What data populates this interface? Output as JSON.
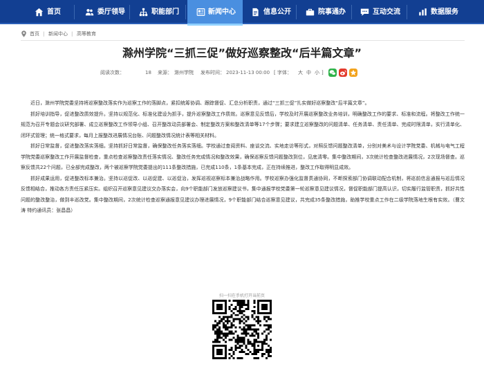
{
  "nav": {
    "items": [
      {
        "label": "首页",
        "icon": "home-icon"
      },
      {
        "label": "委厅领导",
        "icon": "people-icon"
      },
      {
        "label": "职能部门",
        "icon": "org-icon"
      },
      {
        "label": "新闻中心",
        "icon": "news-icon",
        "active": true
      },
      {
        "label": "信息公开",
        "icon": "document-icon"
      },
      {
        "label": "院事通办",
        "icon": "briefcase-icon"
      },
      {
        "label": "互动交流",
        "icon": "chat-icon"
      },
      {
        "label": "数据服务",
        "icon": "data-icon"
      }
    ],
    "colors": {
      "bar": "#123f92",
      "active": "#4a8fe0"
    }
  },
  "breadcrumb": {
    "items": [
      "首页",
      "新闻中心",
      "高等教育"
    ],
    "separator": "|"
  },
  "article": {
    "title": "滁州学院“三抓三促”做好巡察整改“后半篇文章”",
    "meta": {
      "views_label": "阅读次数：",
      "views": "18",
      "source_label": "来源：",
      "source": "滁州学院",
      "date_label": "发布时间：",
      "date": "2023-11-13 00:00",
      "font_label": "[ 字体：",
      "font_large": "大",
      "font_medium": "中",
      "font_small": "小",
      "font_close": "]"
    },
    "paragraphs": [
      "近日，滁州学院党委坚持将巡察整改落实作为巡察工作的落脚点，紧扣统筹协调、跟踪督促、汇总分析职责，通过“三抓三促”扎实做好巡察整改“后半篇文章”。",
      "抓好培训指导，促进整改质效提升。坚持以规范化、标准化建设为抓手，提升巡察整改工作质效。巡察意见反馈后，学校及时开展巡察整改业务培训，明确整改工作的要求、标准和流程。将整改工作统一规范为召开专题会议研究部署、成立巡察整改工作领导小组、召开整改动员部署会、制定整改方案和整改清单等17个步骤；要求建立巡察整改的问题清单、任务清单、责任清单、完成时限清单，实行清单化、闭环式管理；统一格式要求，每月上报整改进展情况台账、问题整改情况统计表等相关材料。",
      "抓好日常监督，促进整改落实落细。坚持抓好日常监督，确保整改任务落实落细。学校通过查阅资料、座谈交流、实地走访等形式，对照反馈问题整改清单，分别对美术与设计学院党委、机械与电气工程学院党委巡察整改工作开展监督检查，重点检查巡察整改责任落实情况、整改任务完成情况和整改效果，确保巡察反馈问题整改到位，见底清零。集中整改期间，3次统计检查整改进展情况，2次现场督查。巡察反馈共22个问题，已全部完成整改，两个被巡察学院党委提出的111条整改措施，已完成110条，1条基本完成，正在持续推进，整改工作取得明显成效。",
      "抓好成果运用，促进整改标本兼治。坚持以巡促改、以巡促建、以巡促治，发挥巡视巡察标本兼治战略作用。学校巡察办强化监督贯通协同，不断探索部门协调联动配合机制，将巡前信息通报与巡后情况反馈相结合，推动各方责任压紧压实。组织召开巡察意见建议交办落实会，向9个职能部门发放巡察建议书，集中通报学校党委第一轮巡察意见建议情况，督促职能部门提高认识，切实履行监管职责，抓好共性问题的整改整治，做到丰巡改党。集中整改期间，2次统计检查巡察通报意见建议办理进展情况，9个职能部门结合巡察意见建议，共完成35条整改措施，助推学校重点工作在二级学院落地生根有实效。（曹文涛 特约通讯员：张昌昌）"
    ]
  },
  "qr": {
    "caption": "扫一扫在手机打开当前页"
  },
  "share": {
    "icons": [
      {
        "name": "wechat-share-icon",
        "color": "#2fb24a"
      },
      {
        "name": "weibo-share-icon",
        "color": "#e33a2c"
      },
      {
        "name": "qzone-share-icon",
        "color": "#f2a21b"
      }
    ]
  }
}
